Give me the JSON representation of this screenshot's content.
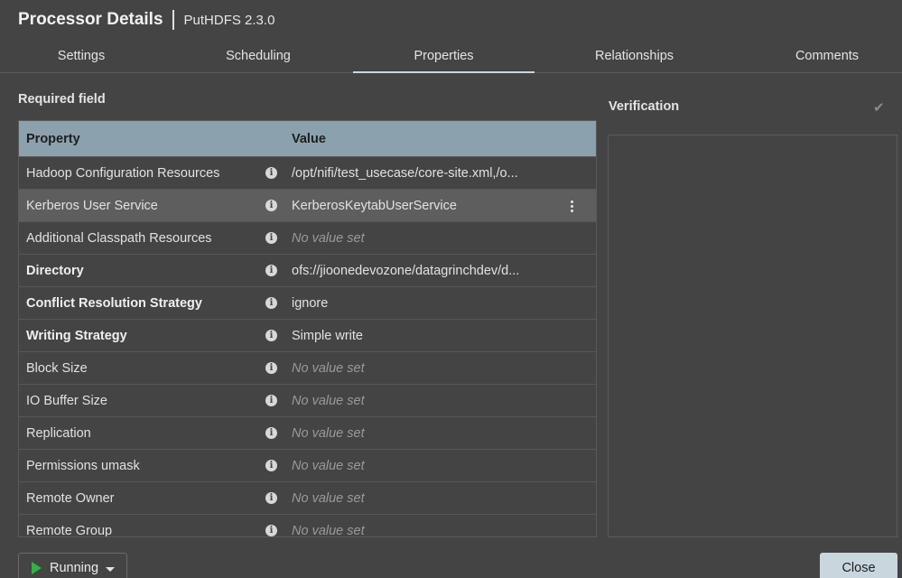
{
  "header": {
    "title": "Processor Details",
    "subtitle": "PutHDFS 2.3.0"
  },
  "tabs": [
    {
      "label": "Settings"
    },
    {
      "label": "Scheduling"
    },
    {
      "label": "Properties",
      "active": true
    },
    {
      "label": "Relationships"
    },
    {
      "label": "Comments"
    }
  ],
  "required_field_label": "Required field",
  "table": {
    "headers": {
      "property": "Property",
      "value": "Value"
    },
    "rows": [
      {
        "name": "Hadoop Configuration Resources",
        "value": "/opt/nifi/test_usecase/core-site.xml,/o...",
        "required": false,
        "empty": false
      },
      {
        "name": "Kerberos User Service",
        "value": "KerberosKeytabUserService",
        "required": false,
        "empty": false,
        "selected": true
      },
      {
        "name": "Additional Classpath Resources",
        "value": "No value set",
        "required": false,
        "empty": true
      },
      {
        "name": "Directory",
        "value": "ofs://jioonedevozone/datagrinchdev/d...",
        "required": true,
        "empty": false
      },
      {
        "name": "Conflict Resolution Strategy",
        "value": "ignore",
        "required": true,
        "empty": false
      },
      {
        "name": "Writing Strategy",
        "value": "Simple write",
        "required": true,
        "empty": false
      },
      {
        "name": "Block Size",
        "value": "No value set",
        "required": false,
        "empty": true
      },
      {
        "name": "IO Buffer Size",
        "value": "No value set",
        "required": false,
        "empty": true
      },
      {
        "name": "Replication",
        "value": "No value set",
        "required": false,
        "empty": true
      },
      {
        "name": "Permissions umask",
        "value": "No value set",
        "required": false,
        "empty": true
      },
      {
        "name": "Remote Owner",
        "value": "No value set",
        "required": false,
        "empty": true
      },
      {
        "name": "Remote Group",
        "value": "No value set",
        "required": false,
        "empty": true
      }
    ]
  },
  "verification": {
    "title": "Verification",
    "icon": "check-icon"
  },
  "footer": {
    "run_label": "Running",
    "close_label": "Close"
  },
  "colors": {
    "background": "#444444",
    "header_row": "#8ba1ae",
    "run_icon": "#2fb344",
    "close_button": "#c9d6de"
  }
}
